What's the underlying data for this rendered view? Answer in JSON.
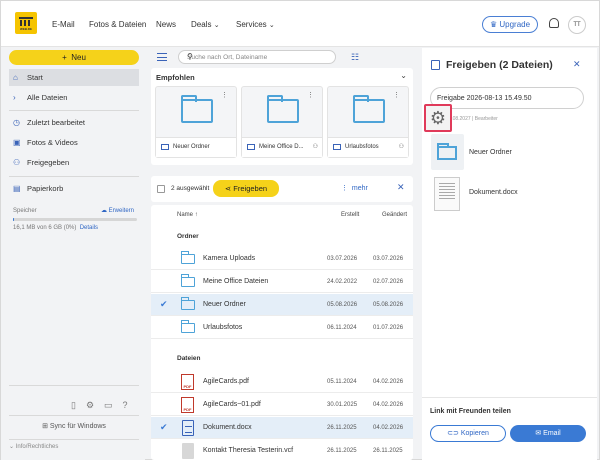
{
  "header": {
    "logo_text": "WEB.DE",
    "nav": [
      "E-Mail",
      "Fotos & Dateien",
      "News",
      "Deals",
      "Services"
    ],
    "upgrade_label": "Upgrade",
    "avatar_initials": "TT"
  },
  "sidebar": {
    "new_label": "Neu",
    "items": [
      {
        "label": "Start",
        "icon": "home-icon"
      },
      {
        "label": "Alle Dateien",
        "icon": "chevron-right-icon"
      },
      {
        "label": "Zuletzt bearbeitet",
        "icon": "clock-icon"
      },
      {
        "label": "Fotos & Videos",
        "icon": "image-icon"
      },
      {
        "label": "Freigegeben",
        "icon": "users-icon"
      },
      {
        "label": "Papierkorb",
        "icon": "trash-icon"
      }
    ],
    "storage_label": "Speicher",
    "storage_link": "Erweitern",
    "storage_used": "16,1 MB von 6 GB (0%)",
    "storage_details": "Details",
    "storage_fraction": 0.003,
    "sync_label": "Sync für Windows",
    "info_label": "Info/Rechtliches"
  },
  "main": {
    "search_placeholder": "Suche nach Ort, Dateiname",
    "recommended_title": "Empfohlen",
    "tiles": [
      {
        "name": "Neuer Ordner"
      },
      {
        "name": "Meine Office D..."
      },
      {
        "name": "Urlaubsfotos"
      }
    ],
    "selection_count": "2 ausgewählt",
    "share_label": "Freigeben",
    "more_label": "mehr",
    "columns": {
      "name": "Name",
      "created": "Erstellt",
      "modified": "Geändert"
    },
    "section_folders": "Ordner",
    "section_files": "Dateien",
    "folders": [
      {
        "name": "Kamera Uploads",
        "created": "03.07.2026",
        "modified": "03.07.2026",
        "selected": false
      },
      {
        "name": "Meine Office Dateien",
        "created": "24.02.2022",
        "modified": "02.07.2026",
        "selected": false
      },
      {
        "name": "Neuer Ordner",
        "created": "05.08.2026",
        "modified": "05.08.2026",
        "selected": true
      },
      {
        "name": "Urlaubsfotos",
        "created": "06.11.2024",
        "modified": "01.07.2026",
        "selected": false
      }
    ],
    "files": [
      {
        "name": "AgileCards.pdf",
        "created": "05.11.2024",
        "modified": "04.02.2026",
        "type": "pdf",
        "selected": false
      },
      {
        "name": "AgileCards~01.pdf",
        "created": "30.01.2025",
        "modified": "04.02.2026",
        "type": "pdf",
        "selected": false
      },
      {
        "name": "Dokument.docx",
        "created": "26.11.2025",
        "modified": "04.02.2026",
        "type": "doc",
        "selected": true
      },
      {
        "name": "Kontakt Theresia Testerin.vcf",
        "created": "26.11.2025",
        "modified": "26.11.2025",
        "type": "vcf",
        "selected": false
      }
    ]
  },
  "panel": {
    "title": "Freigeben (2 Dateien)",
    "share_name": "Freigabe 2026-08-13 15.49.50",
    "share_date": "11.08.2027 | Bearbeiter",
    "items": [
      "Neuer Ordner",
      "Dokument.docx"
    ],
    "link_title": "Link mit Freunden teilen",
    "copy_label": "Kopieren",
    "email_label": "Email"
  }
}
